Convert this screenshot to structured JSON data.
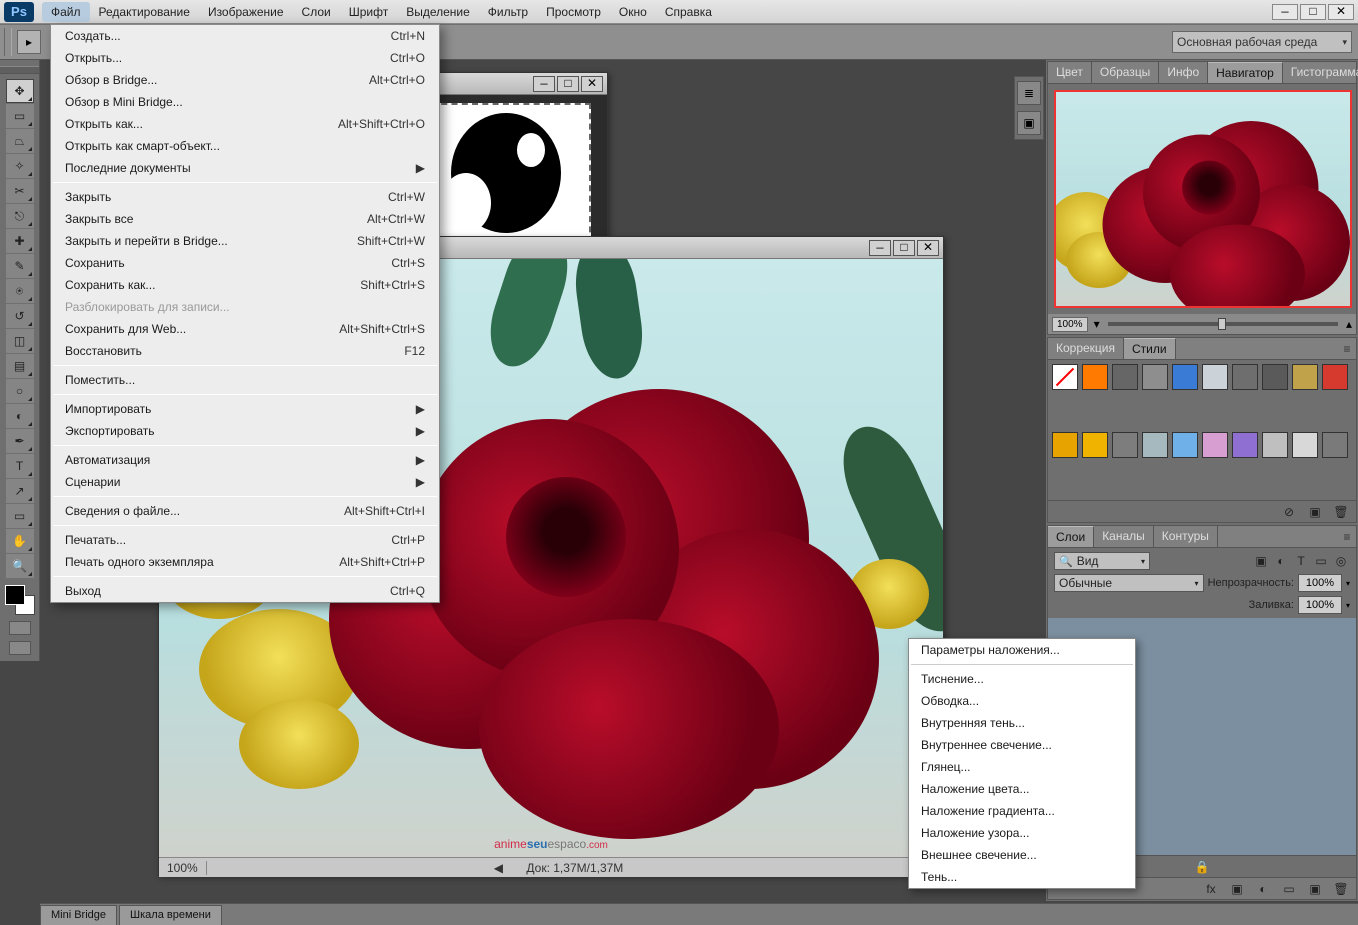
{
  "app": {
    "logo": "Ps"
  },
  "menubar": {
    "items": [
      "Файл",
      "Редактирование",
      "Изображение",
      "Слои",
      "Шрифт",
      "Выделение",
      "Фильтр",
      "Просмотр",
      "Окно",
      "Справка"
    ],
    "active_index": 0
  },
  "file_menu": {
    "groups": [
      [
        {
          "label": "Создать...",
          "shortcut": "Ctrl+N"
        },
        {
          "label": "Открыть...",
          "shortcut": "Ctrl+O"
        },
        {
          "label": "Обзор в Bridge...",
          "shortcut": "Alt+Ctrl+O"
        },
        {
          "label": "Обзор в Mini Bridge..."
        },
        {
          "label": "Открыть как...",
          "shortcut": "Alt+Shift+Ctrl+O"
        },
        {
          "label": "Открыть как смарт-объект..."
        },
        {
          "label": "Последние документы",
          "submenu": true
        }
      ],
      [
        {
          "label": "Закрыть",
          "shortcut": "Ctrl+W"
        },
        {
          "label": "Закрыть все",
          "shortcut": "Alt+Ctrl+W"
        },
        {
          "label": "Закрыть и перейти в Bridge...",
          "shortcut": "Shift+Ctrl+W"
        },
        {
          "label": "Сохранить",
          "shortcut": "Ctrl+S"
        },
        {
          "label": "Сохранить как...",
          "shortcut": "Shift+Ctrl+S"
        },
        {
          "label": "Разблокировать для записи...",
          "disabled": true
        },
        {
          "label": "Сохранить для Web...",
          "shortcut": "Alt+Shift+Ctrl+S"
        },
        {
          "label": "Восстановить",
          "shortcut": "F12"
        }
      ],
      [
        {
          "label": "Поместить..."
        }
      ],
      [
        {
          "label": "Импортировать",
          "submenu": true
        },
        {
          "label": "Экспортировать",
          "submenu": true
        }
      ],
      [
        {
          "label": "Автоматизация",
          "submenu": true
        },
        {
          "label": "Сценарии",
          "submenu": true
        }
      ],
      [
        {
          "label": "Сведения о файле...",
          "shortcut": "Alt+Shift+Ctrl+I"
        }
      ],
      [
        {
          "label": "Печатать...",
          "shortcut": "Ctrl+P"
        },
        {
          "label": "Печать одного экземпляра",
          "shortcut": "Alt+Shift+Ctrl+P"
        }
      ],
      [
        {
          "label": "Выход",
          "shortcut": "Ctrl+Q"
        }
      ]
    ]
  },
  "fx_menu": {
    "items": [
      "Параметры наложения...",
      "sep",
      "Тиснение...",
      "Обводка...",
      "Внутренняя тень...",
      "Внутреннее свечение...",
      "Глянец...",
      "Наложение цвета...",
      "Наложение градиента...",
      "Наложение узора...",
      "Внешнее свечение...",
      "Тень..."
    ]
  },
  "workspace": {
    "label": "Основная рабочая среда"
  },
  "panels": {
    "color_tabs": [
      "Цвет",
      "Образцы",
      "Инфо",
      "Навигатор",
      "Гистограмма"
    ],
    "color_active": 3,
    "nav_zoom": "100%",
    "adjust_tabs": [
      "Коррекция",
      "Стили"
    ],
    "adjust_active": 1,
    "style_colors": [
      "#ffffff",
      "#ff7a00",
      "#666666",
      "#8e8e8e",
      "#3a7bd5",
      "#cbd3d8",
      "#6e6e6e",
      "#5a5a5a",
      "#bfa24a",
      "#d63a2f",
      "#e7a400",
      "#f0b400",
      "#7d7d7d",
      "#a6b9be",
      "#6fb0e8",
      "#d79ed2",
      "#8f6fd1",
      "#bfbfbf",
      "#d8d8d8",
      "#7a7a7a"
    ],
    "layers_tabs": [
      "Слои",
      "Каналы",
      "Контуры"
    ],
    "layers_active": 0,
    "layer_filter": "Вид",
    "blend_mode": "Обычные",
    "opacity_label": "Непрозрачность:",
    "opacity_value": "100%",
    "fill_label": "Заливка:",
    "fill_value": "100%",
    "lock_text": "🔒"
  },
  "bottom": {
    "tabs": [
      "Mini Bridge",
      "Шкала времени"
    ]
  },
  "doc_front": {
    "zoom": "100%",
    "info": "Док: 1,37M/1,37M",
    "watermark_a": "anime",
    "watermark_b": "seu",
    "watermark_c": "espaco",
    "watermark_d": ".com"
  },
  "tools": [
    "move",
    "marquee",
    "lasso",
    "wand",
    "crop",
    "eyedropper",
    "heal",
    "brush",
    "stamp",
    "history",
    "eraser",
    "gradient",
    "blur",
    "dodge",
    "pen",
    "type",
    "path",
    "shape",
    "hand",
    "zoom"
  ],
  "footer_icons": [
    "fx",
    "mask",
    "adj",
    "group",
    "new",
    "trash"
  ],
  "style_footer_icons": [
    "clear",
    "new",
    "trash"
  ],
  "layer_icons": [
    "img",
    "fx",
    "T",
    "shape",
    "smart"
  ]
}
